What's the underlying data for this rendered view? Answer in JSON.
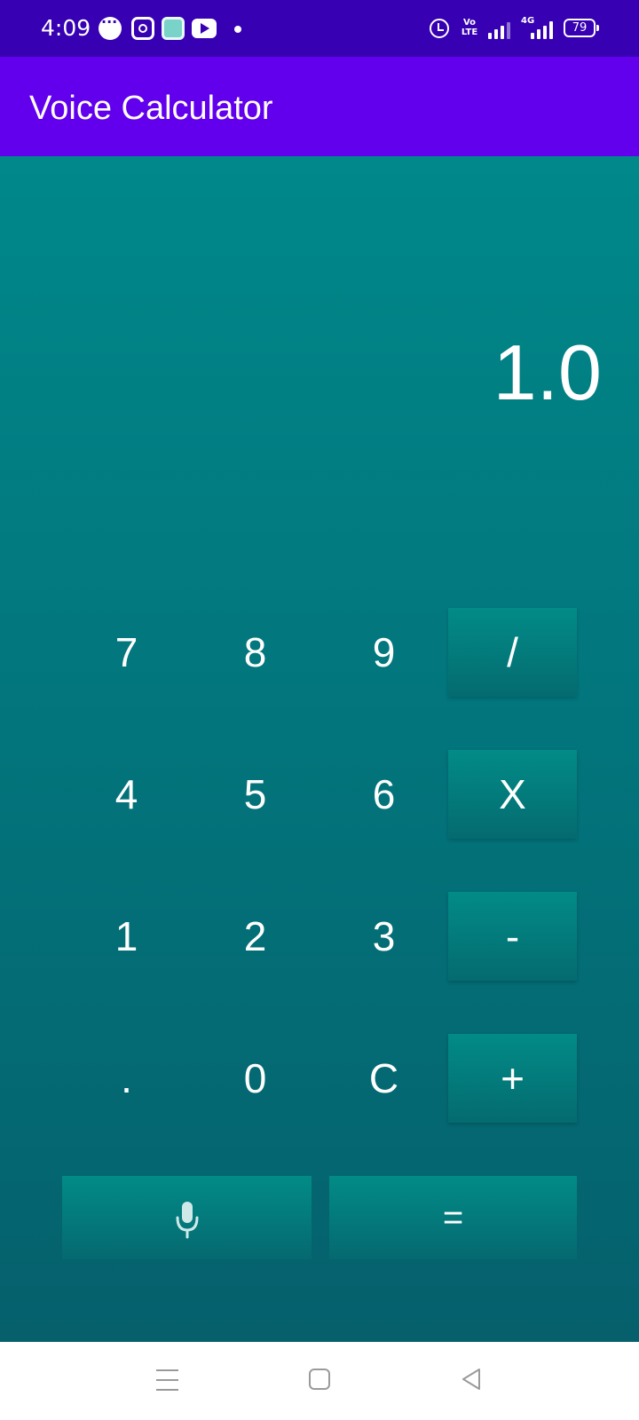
{
  "status_bar": {
    "time": "4:09",
    "volte_top": "Vo",
    "volte_bottom": "LTE",
    "network": "4G",
    "battery": "79",
    "notification_icons": [
      "chat-icon",
      "instagram-icon",
      "app-icon",
      "youtube-icon",
      "dot-icon"
    ],
    "status_icons": [
      "alarm-icon",
      "volte-icon",
      "signal-icon",
      "signal-icon",
      "battery-icon"
    ]
  },
  "app_bar": {
    "title": "Voice Calculator",
    "color": "#6200ee"
  },
  "display": {
    "value": "1.0"
  },
  "keypad": {
    "rows": [
      [
        "7",
        "8",
        "9",
        "/"
      ],
      [
        "4",
        "5",
        "6",
        "X"
      ],
      [
        "1",
        "2",
        "3",
        "-"
      ],
      [
        ".",
        "0",
        "C",
        "+"
      ]
    ],
    "equals": "=",
    "mic_icon": "microphone-icon"
  },
  "nav_bar": {
    "icons": [
      "menu-icon",
      "home-icon",
      "back-icon"
    ]
  },
  "colors": {
    "status_bar": "#3700b3",
    "gradient_top": "#00888a",
    "gradient_bottom": "#05606c"
  }
}
